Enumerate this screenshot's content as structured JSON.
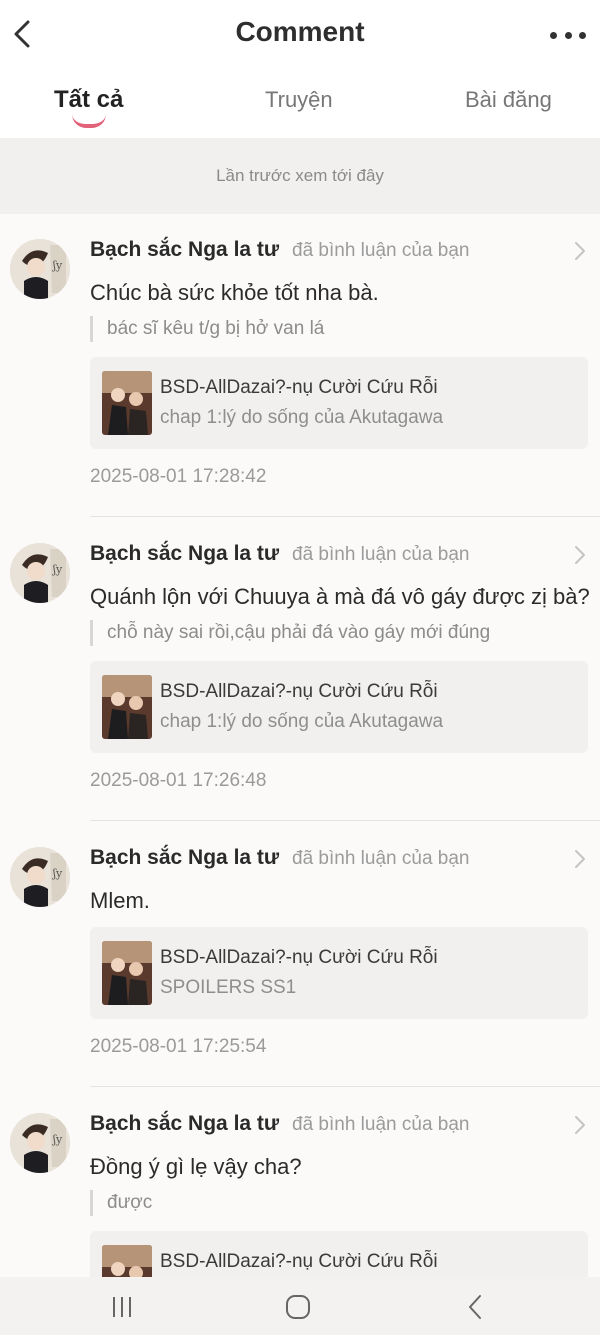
{
  "header": {
    "title": "Comment",
    "back_icon": "chevron-left-icon",
    "more_icon": "more-horizontal-icon"
  },
  "tabs": [
    {
      "label": "Tất cả",
      "active": true
    },
    {
      "label": "Truyện",
      "active": false
    },
    {
      "label": "Bài đăng",
      "active": false
    }
  ],
  "accent_color": "#e2627a",
  "last_seen": "Lần trước xem tới đây",
  "comments": [
    {
      "user": "Bạch sắc Nga la tư",
      "action": "đã bình luận của bạn",
      "text": "Chúc bà sức khỏe tốt nha bà.",
      "quote": "bác sĩ kêu t/g bị hở van lá",
      "story_title": "BSD-AllDazai?-nụ Cười Cứu Rỗi",
      "story_chapter": "chap 1:lý do sống của Akutagawa",
      "time": "2025-08-01 17:28:42"
    },
    {
      "user": "Bạch sắc Nga la tư",
      "action": "đã bình luận của bạn",
      "text": "Quánh lộn với Chuuya à mà đá vô gáy được zị bà?",
      "quote": "chỗ này sai rồi,cậu phải đá vào gáy mới đúng",
      "story_title": "BSD-AllDazai?-nụ Cười Cứu Rỗi",
      "story_chapter": "chap 1:lý do sống của Akutagawa",
      "time": "2025-08-01 17:26:48"
    },
    {
      "user": "Bạch sắc Nga la tư",
      "action": "đã bình luận của bạn",
      "text": "Mlem.",
      "quote": "",
      "story_title": "BSD-AllDazai?-nụ Cười Cứu Rỗi",
      "story_chapter": "SPOILERS SS1",
      "time": "2025-08-01 17:25:54"
    },
    {
      "user": "Bạch sắc Nga la tư",
      "action": "đã bình luận của bạn",
      "text": "Đồng ý gì lẹ vậy cha?",
      "quote": "được",
      "story_title": "BSD-AllDazai?-nụ Cười Cứu Rỗi",
      "story_chapter": "",
      "time": ""
    }
  ],
  "nav": {
    "recents_icon": "recent-apps-icon",
    "home_icon": "home-icon",
    "back_icon": "back-icon"
  }
}
